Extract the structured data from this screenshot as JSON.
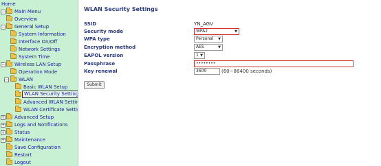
{
  "sidebar": {
    "items": [
      {
        "label": "Home"
      },
      {
        "label": "Main Menu"
      },
      {
        "label": "Overview"
      },
      {
        "label": "General Setup"
      },
      {
        "label": "System Information"
      },
      {
        "label": "Interface On/Off"
      },
      {
        "label": "Network Settings"
      },
      {
        "label": "System Time"
      },
      {
        "label": "Wireless LAN Setup"
      },
      {
        "label": "Operation Mode"
      },
      {
        "label": "WLAN"
      },
      {
        "label": "Basic WLAN Setup"
      },
      {
        "label": "WLAN Security Settings"
      },
      {
        "label": "Advanced WLAN Settings"
      },
      {
        "label": "WLAN Certificate Settings"
      },
      {
        "label": "Advanced Setup"
      },
      {
        "label": "Logs and Notifications"
      },
      {
        "label": "Status"
      },
      {
        "label": "Maintenance"
      },
      {
        "label": "Save Configuration"
      },
      {
        "label": "Restart"
      },
      {
        "label": "Logout"
      }
    ]
  },
  "main": {
    "title": "WLAN Security Settings",
    "ssid": {
      "label": "SSID",
      "value": "YN_AGV"
    },
    "security_mode": {
      "label": "Security mode",
      "value": "WPA2"
    },
    "wpa_type": {
      "label": "WPA type",
      "value": "Personal"
    },
    "encryption": {
      "label": "Encryption method",
      "value": "AES"
    },
    "eapol": {
      "label": "EAPOL version",
      "value": "1"
    },
    "passphrase": {
      "label": "Passphrase",
      "value": "••••••••"
    },
    "key_renewal": {
      "label": "Key renewal",
      "value": "3600",
      "hint": "(60~86400 seconds)"
    },
    "submit_label": "Submit"
  },
  "colors": {
    "sidebar_bg": "#c8f0d3",
    "label_color": "#2a3a7a",
    "highlight_border": "#d03030"
  }
}
